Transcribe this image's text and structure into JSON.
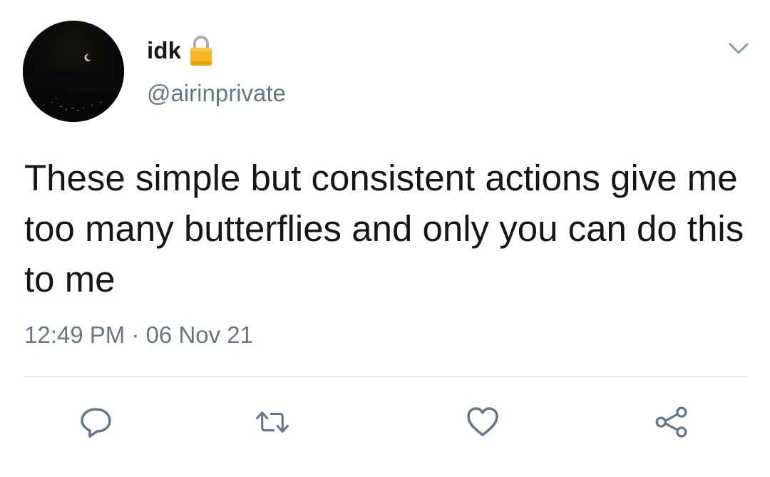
{
  "tweet": {
    "display_name": "idk",
    "handle": "@airinprivate",
    "text": "These simple but consistent actions give me too many butterflies and only you can do this to me",
    "timestamp": "12:49 PM · 06 Nov 21"
  },
  "icons": {
    "account_lock": "lock-icon",
    "more_menu": "chevron-down-icon",
    "reply": "reply-icon",
    "retweet": "retweet-icon",
    "like": "heart-icon",
    "share": "share-icon"
  },
  "colors": {
    "text_primary": "#14171a",
    "text_secondary": "#657786",
    "divider": "#d6dde2",
    "lock_gold": "#f4b321"
  }
}
